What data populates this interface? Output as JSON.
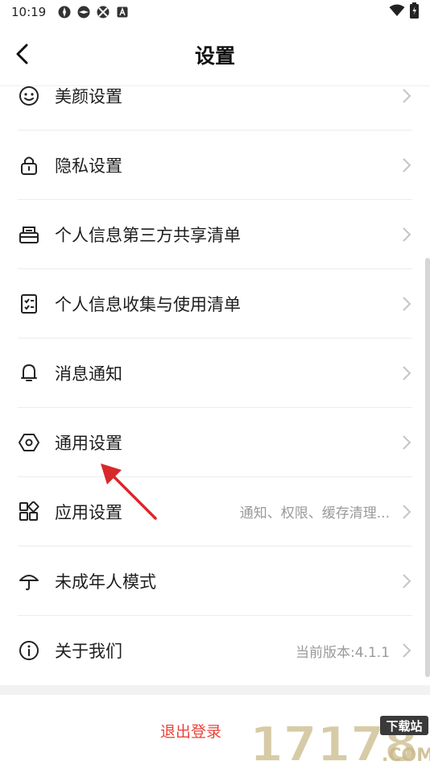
{
  "status": {
    "time": "10:19"
  },
  "nav": {
    "title": "设置"
  },
  "items": [
    {
      "label": "美颜设置",
      "icon": "face-smile-icon",
      "value": ""
    },
    {
      "label": "隐私设置",
      "icon": "lock-icon",
      "value": ""
    },
    {
      "label": "个人信息第三方共享清单",
      "icon": "share-list-icon",
      "value": ""
    },
    {
      "label": "个人信息收集与使用清单",
      "icon": "checklist-icon",
      "value": ""
    },
    {
      "label": "消息通知",
      "icon": "bell-icon",
      "value": ""
    },
    {
      "label": "通用设置",
      "icon": "hex-gear-icon",
      "value": ""
    },
    {
      "label": "应用设置",
      "icon": "app-grid-icon",
      "value": "通知、权限、缓存清理..."
    },
    {
      "label": "未成年人模式",
      "icon": "umbrella-icon",
      "value": ""
    },
    {
      "label": "关于我们",
      "icon": "info-icon",
      "value": "当前版本:4.1.1"
    }
  ],
  "logout": {
    "label": "退出登录"
  },
  "watermark": {
    "brand": "17178",
    "tag": "下载站",
    "domain": ".COM"
  },
  "colors": {
    "accent": "#e8443a",
    "arrow": "#d8282a"
  }
}
